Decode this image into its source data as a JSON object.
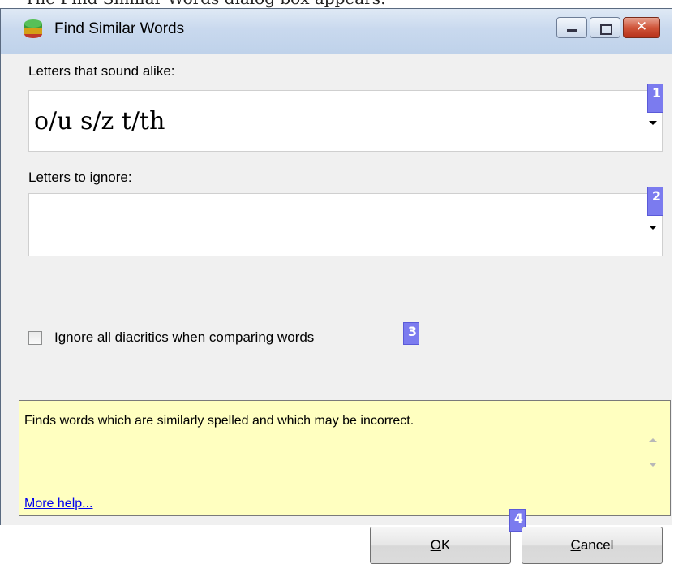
{
  "top_fragment": "The Find Similar Words dialog box appears:",
  "window": {
    "title": "Find Similar Words",
    "icons": [
      "app-icon",
      "minimize-icon",
      "maximize-icon",
      "close-icon"
    ]
  },
  "sounds_alike": {
    "label": "Letters that sound alike:",
    "value": "o/u s/z t/th",
    "badge": "1"
  },
  "ignore_letters": {
    "label": "Letters to ignore:",
    "value": "",
    "badge": "2"
  },
  "diacritics": {
    "label": "Ignore all diacritics when comparing words",
    "checked": false,
    "badge": "3"
  },
  "help": {
    "text": "Finds words which are similarly spelled and which may be incorrect.",
    "link": "More help..."
  },
  "buttons": {
    "ok_label": "OK",
    "ok_mnemonic": "O",
    "ok_rest": "K",
    "cancel_label": "Cancel",
    "cancel_mnemonic": "C",
    "cancel_rest": "ancel",
    "badge": "4"
  },
  "colors": {
    "badge": "#7b7bef",
    "help_background": "#ffffc0",
    "link": "#0000ee"
  }
}
